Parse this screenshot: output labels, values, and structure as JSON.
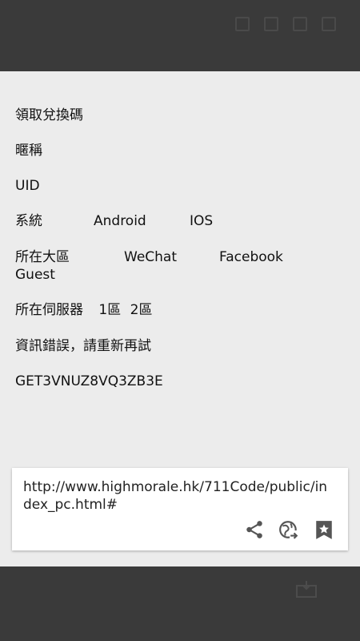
{
  "form": {
    "title": "領取兌換碼",
    "nickname_label": "暱稱",
    "uid_label": "UID",
    "system": {
      "label": "系統",
      "options": [
        "Android",
        "IOS"
      ]
    },
    "region": {
      "label": "所在大區",
      "options": [
        "WeChat",
        "Facebook",
        "Guest"
      ]
    },
    "server": {
      "label": "所在伺服器",
      "options": [
        "1區",
        "2區"
      ]
    },
    "error_message": "資訊錯誤，請重新再試",
    "code": "GET3VNUZ8VQ3ZB3E"
  },
  "link_card": {
    "url": "http://www.highmorale.hk/711Code/public/index_pc.html#"
  },
  "icons": {
    "share": "share-icon",
    "open_in_browser": "globe-arrow-icon",
    "bookmark": "bookmark-star-icon"
  },
  "colors": {
    "overlay_bg": "#ececec",
    "dim_bg": "#3a3a3a",
    "icon": "#555555"
  }
}
